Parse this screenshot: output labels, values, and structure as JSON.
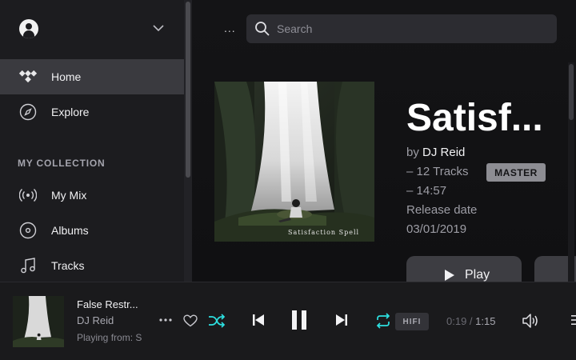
{
  "sidebar": {
    "nav": [
      {
        "label": "Home",
        "icon": "home-icon",
        "active": true
      },
      {
        "label": "Explore",
        "icon": "compass-icon",
        "active": false
      }
    ],
    "section_title": "MY COLLECTION",
    "collection": [
      {
        "label": "My Mix",
        "icon": "radio-icon"
      },
      {
        "label": "Albums",
        "icon": "disc-icon"
      },
      {
        "label": "Tracks",
        "icon": "music-note-icon"
      }
    ]
  },
  "header": {
    "more_label": "...",
    "search_placeholder": "Search"
  },
  "album": {
    "title": "Satisf...",
    "by_prefix": "by ",
    "artist": "DJ Reid",
    "tracks": "– 12 Tracks",
    "duration": "– 14:57",
    "quality_badge": "MASTER",
    "release_label": "Release date",
    "release_date": "03/01/2019",
    "cover_caption": "Satisfaction Spell",
    "play_label": "Play"
  },
  "player": {
    "track_title": "False Restr...",
    "track_artist": "DJ Reid",
    "playing_from": "Playing from: S",
    "quality": "HIFI",
    "current_time": "0:19",
    "separator": " / ",
    "total_time": "1:15"
  },
  "colors": {
    "accent": "#2de0e0",
    "background": "#101012",
    "sidebar": "#1c1c1f",
    "active_item": "#3a3a3f"
  }
}
